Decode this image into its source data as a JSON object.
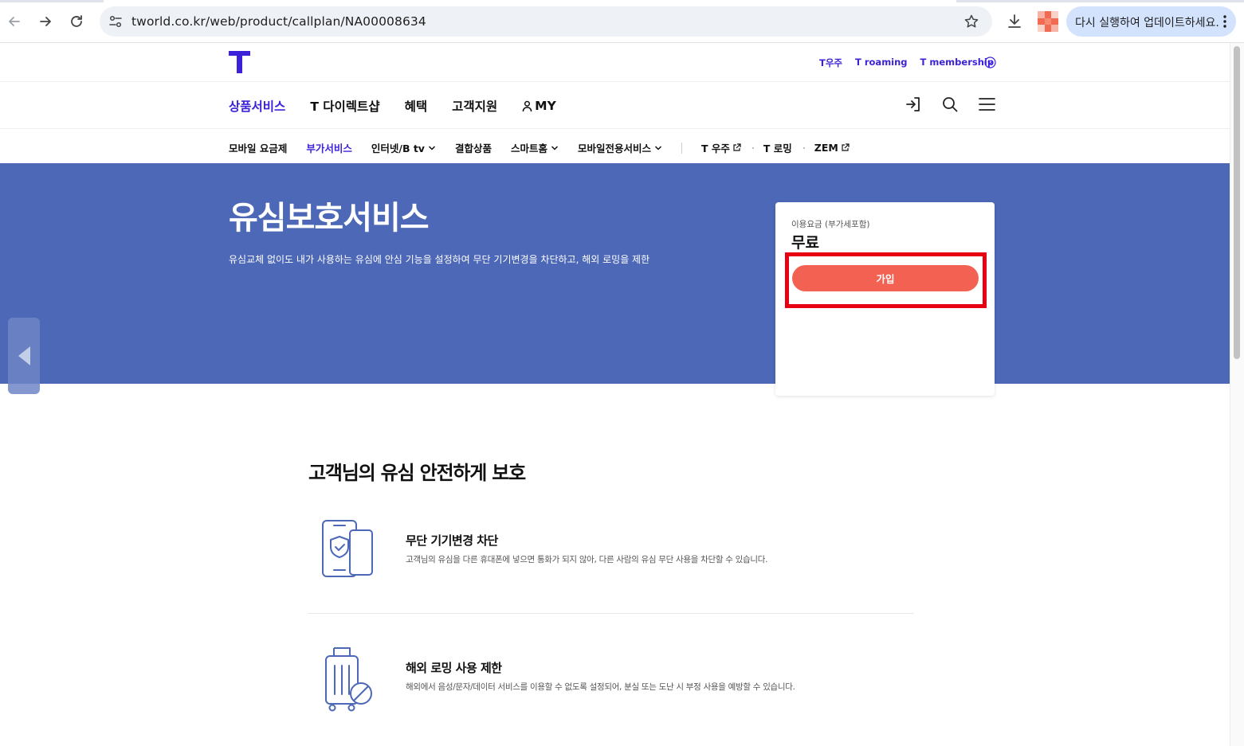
{
  "browser": {
    "url": "tworld.co.kr/web/product/callplan/NA00008634",
    "update_label": "다시 실행하여 업데이트하세요."
  },
  "site": {
    "util_links": [
      "T우주",
      "T roaming",
      "T membership"
    ],
    "gnb": [
      "상품서비스",
      "T 다이렉트샵",
      "혜택",
      "고객지원",
      "MY"
    ],
    "gnb_active": "상품서비스",
    "gnb_my_icon": "person-icon",
    "lnb": {
      "mobile_plan": "모바일 요금제",
      "addon": "부가서비스",
      "internet": "인터넷/B tv",
      "bundle": "결합상품",
      "smarthome": "스마트홈",
      "mobile_only": "모바일전용서비스",
      "t_universe": "T 우주",
      "t_roaming": "T 로밍",
      "zem": "ZEM"
    }
  },
  "hero": {
    "title": "유심보호서비스",
    "description": "유심교체 없이도 내가 사용하는 유심에 안심 기능을 설정하여 무단 기기변경을 차단하고, 해외 로밍을 제한",
    "price_label": "이용요금 (부가세포함)",
    "price": "무료",
    "join_label": "가입",
    "highlight_color": "#e60012",
    "join_color": "#f26152",
    "hero_color": "#4d68b7"
  },
  "content": {
    "section_title": "고객님의 유심 안전하게 보호",
    "features": [
      {
        "icon": "phone-shield-icon",
        "title": "무단 기기변경 차단",
        "description": "고객님의 유심을 다른 휴대폰에 넣으면 통화가 되지 않아, 다른 사람의 유심 무단 사용을 차단할 수 있습니다."
      },
      {
        "icon": "luggage-blocked-icon",
        "title": "해외 로밍 사용 제한",
        "description": "해외에서 음성/문자/데이터 서비스를 이용할 수 없도록 설정되어, 분실 또는 도난 시 부정 사용을 예방할 수 있습니다."
      }
    ]
  },
  "brand_color": "#3b22d8"
}
